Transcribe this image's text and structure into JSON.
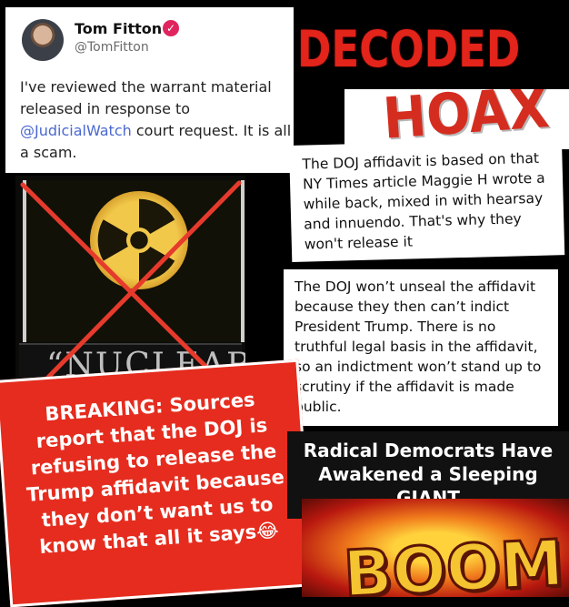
{
  "tweet": {
    "name": "Tom Fitton",
    "verified_glyph": "✓",
    "handle": "@TomFitton",
    "body_before": "I've reviewed the warrant material released in response to ",
    "mention": "@JudicialWatch",
    "body_after": " court request. It is all a scam."
  },
  "decoded": "DECODED",
  "hoax": "HOAX",
  "card1": "The DOJ affidavit is based on that NY Times article Maggie H wrote a while back, mixed in with hearsay and innuendo. That's why they won't release it",
  "card2": "The DOJ won’t unseal the affidavit because they then can’t indict President Trump. There is no truthful legal basis in the affidavit, so an indictment won’t stand up to scrutiny if the affidavit is made public.",
  "nuclear_label": "“NUCLEAR",
  "breaking": "BREAKING: Sources report that the DOJ is refusing to release the Trump affidavit because they don’t want us to know that all it says😂",
  "radical": "Radical Democrats Have Awakened a Sleeping GIANT",
  "boom": "BOOM",
  "colors": {
    "red": "#e52c1e",
    "mention": "#4a68d0",
    "hoax": "#d42d20"
  },
  "icons": [
    "verified-badge-icon",
    "radiation-icon",
    "red-x-icon"
  ]
}
